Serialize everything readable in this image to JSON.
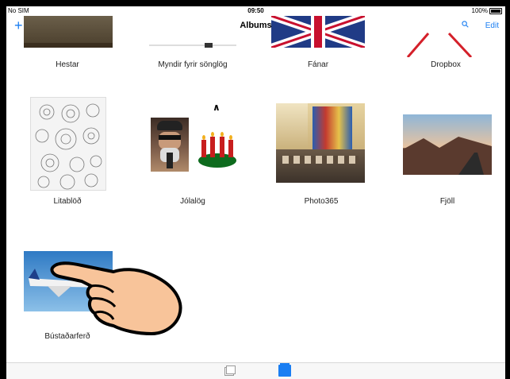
{
  "status_bar": {
    "carrier": "No SIM",
    "time": "09:50",
    "battery": "100%"
  },
  "nav": {
    "title": "Albums",
    "edit_label": "Edit",
    "add_icon": "+"
  },
  "albums": [
    {
      "name": "Hestar"
    },
    {
      "name": "Myndir fyrir sönglög"
    },
    {
      "name": "Fánar"
    },
    {
      "name": "Dropbox"
    },
    {
      "name": "Litablöð"
    },
    {
      "name": "Jólalög"
    },
    {
      "name": "Photo365"
    },
    {
      "name": "Fjöll"
    },
    {
      "name": "Bústaðarferð"
    }
  ],
  "colors": {
    "accent": "#1a7ef2"
  }
}
